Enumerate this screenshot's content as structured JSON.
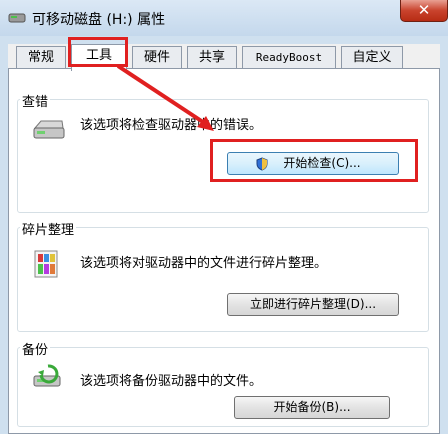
{
  "window": {
    "title": "可移动磁盘 (H:) 属性",
    "close_label": "✕"
  },
  "tabs": [
    {
      "label": "常规",
      "active": false
    },
    {
      "label": "工具",
      "active": true
    },
    {
      "label": "硬件",
      "active": false
    },
    {
      "label": "共享",
      "active": false
    },
    {
      "label": "ReadyBoost",
      "active": false
    },
    {
      "label": "自定义",
      "active": false
    }
  ],
  "error_check": {
    "title": "查错",
    "description": "该选项将检查驱动器中的错误。",
    "button_label": "开始检查(C)..."
  },
  "defrag": {
    "title": "碎片整理",
    "description": "该选项将对驱动器中的文件进行碎片整理。",
    "button_label": "立即进行碎片整理(D)..."
  },
  "backup": {
    "title": "备份",
    "description": "该选项将备份驱动器中的文件。",
    "button_label": "开始备份(B)..."
  },
  "colors": {
    "highlight": "#e02020",
    "window_frame": "#cfe0ef"
  },
  "icons": {
    "title": "drive-properties-icon",
    "close": "close-icon",
    "error_check": "drive-icon",
    "defrag": "defrag-icon",
    "backup": "backup-icon",
    "shield": "uac-shield-icon"
  }
}
